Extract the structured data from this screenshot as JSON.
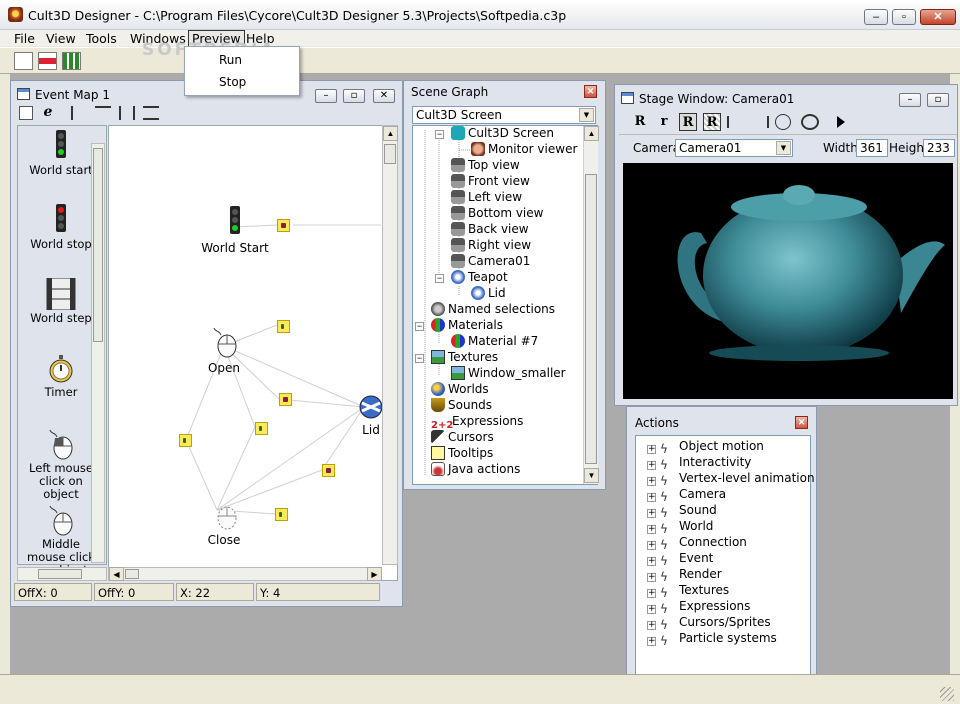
{
  "app": {
    "title": "Cult3D Designer - C:\\Program Files\\Cycore\\Cult3D Designer 5.3\\Projects\\Softpedia.c3p",
    "watermark": "SOFTPEDIA"
  },
  "menu": [
    "File",
    "View",
    "Tools",
    "Windows",
    "Preview",
    "Help"
  ],
  "preview_menu": [
    "Run",
    "Stop"
  ],
  "event_map": {
    "title": "Event Map 1",
    "library": [
      "World start",
      "World stop",
      "World step",
      "Timer",
      "Left mouse click on object",
      "Middle mouse click on object"
    ],
    "nodes": {
      "world_start": "World Start",
      "open": "Open",
      "close": "Close",
      "lid": "Lid"
    },
    "status": {
      "offx": "OffX: 0",
      "offy": "OffY: 0",
      "x": "X: 22",
      "y": "Y: 4"
    }
  },
  "scene_graph": {
    "title": "Scene Graph",
    "selector": "Cult3D Screen",
    "items": [
      "Cult3D Screen",
      "Monitor viewer",
      "Top view",
      "Front view",
      "Left view",
      "Bottom view",
      "Back view",
      "Right view",
      "Camera01",
      "Teapot",
      "Lid",
      "Named selections",
      "Materials",
      "Material #7",
      "Textures",
      "Window_smaller",
      "Worlds",
      "Sounds",
      "Expressions",
      "Cursors",
      "Tooltips",
      "Java actions"
    ]
  },
  "stage": {
    "title": "Stage Window: Camera01",
    "tools": [
      "R",
      "r",
      "R",
      "R"
    ],
    "camera_label": "Camera:",
    "camera_value": "Camera01",
    "width_label": "Width",
    "width_value": "361",
    "height_label": "Height",
    "height_value": "233"
  },
  "actions": {
    "title": "Actions",
    "items": [
      "Object motion",
      "Interactivity",
      "Vertex-level animation",
      "Camera",
      "Sound",
      "World",
      "Connection",
      "Event",
      "Render",
      "Textures",
      "Expressions",
      "Cursors/Sprites",
      "Particle systems"
    ]
  },
  "colors": {
    "teapot": "#3f8e9a",
    "stage_bg": "#000000",
    "mdi_bg": "#ababab"
  }
}
